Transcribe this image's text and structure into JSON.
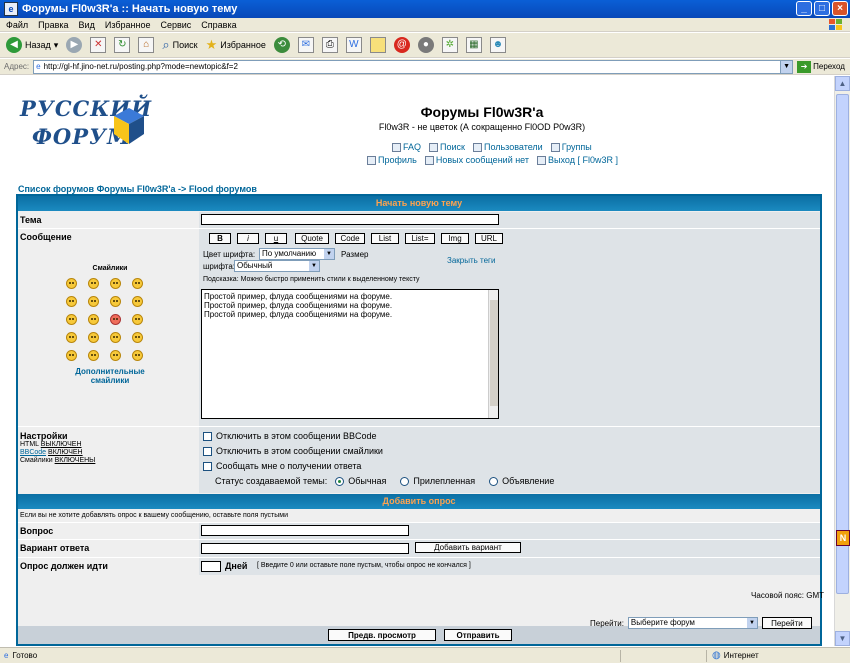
{
  "window": {
    "title": "Форумы Fl0w3R'a :: Начать новую тему",
    "min_label": "_",
    "max_label": "□",
    "close_label": "×"
  },
  "menu": [
    "Файл",
    "Правка",
    "Вид",
    "Избранное",
    "Сервис",
    "Справка"
  ],
  "toolbar": {
    "back": "Назад",
    "search": "Поиск",
    "favorites": "Избранное"
  },
  "address": {
    "label": "Адрес:",
    "url": "http://gl-hf.jino-net.ru/posting.php?mode=newtopic&f=2",
    "go": "Переход"
  },
  "logo": {
    "line1": "РУССКИЙ",
    "line2": "ФОРУМ"
  },
  "site": {
    "title": "Форумы Fl0w3R'a",
    "description": "Fl0w3R - не цветок (А сокращенно Fl0OD P0w3R)",
    "nav1": [
      "FAQ",
      "Поиск",
      "Пользователи",
      "Группы"
    ],
    "nav2": [
      "Профиль",
      "Новых сообщений нет",
      "Выход [ Fl0w3R ]"
    ]
  },
  "breadcrumb": {
    "index": "Список форумов Форумы Fl0w3R'a",
    "sep": "->",
    "forum": "Flood форумов"
  },
  "form": {
    "header": "Начать новую тему",
    "subject_label": "Тема",
    "message_label": "Сообщение",
    "smilies_title": "Смайлики",
    "more_smilies": "Дополнительные смайлики",
    "bbcode": [
      "B",
      "i",
      "u",
      "Quote",
      "Code",
      "List",
      "List=",
      "Img",
      "URL"
    ],
    "font_color_label": "Цвет шрифта:",
    "font_color_value": "По умолчанию",
    "font_size_label": "Размер",
    "font_label": "шрифта:",
    "font_size_value": "Обычный",
    "close_tags": "Закрыть теги",
    "hint": "Подсказка: Можно быстро применить стили к выделенному тексту",
    "message_lines": [
      "Простой пример, флуда сообщениями на форуме.",
      "Простой пример, флуда сообщениями на форуме.",
      "Простой пример, флуда сообщениями на форуме."
    ],
    "options_label": "Настройки",
    "html_label": "HTML",
    "html_state": "ВЫКЛЮЧЕН",
    "bbcode_link": "BBCode",
    "bbcode_state": "ВКЛЮЧЕН",
    "smilies_label": "Смайлики",
    "smilies_state": "ВКЛЮЧЕНЫ",
    "opt_disable_bbcode": "Отключить в этом сообщении BBCode",
    "opt_disable_smilies": "Отключить в этом сообщении смайлики",
    "opt_notify": "Сообщать мне о получении ответа",
    "status_label": "Статус создаваемой темы:",
    "status_normal": "Обычная",
    "status_sticky": "Прилепленная",
    "status_announce": "Объявление"
  },
  "poll": {
    "header": "Добавить опрос",
    "note": "Если вы не хотите добавлять опрос к вашему сообщению, оставьте поля пустыми",
    "question_label": "Вопрос",
    "option_label": "Вариант ответа",
    "add_option": "Добавить вариант",
    "length_label": "Опрос должен идти",
    "days": "Дней",
    "length_hint": "[ Введите 0 или оставьте поле пустым, чтобы опрос не кончался ]"
  },
  "buttons": {
    "preview": "Предв. просмотр",
    "submit": "Отправить"
  },
  "footer": {
    "timezone": "Часовой пояс: GMT",
    "jump_label": "Перейти:",
    "jump_select": "Выберите форум",
    "jump_go": "Перейти"
  },
  "status": {
    "text": "Готово",
    "zone": "Интернет"
  },
  "side_badge": "N",
  "colors": {
    "accent": "#006699",
    "header_text": "#FFA34F"
  }
}
